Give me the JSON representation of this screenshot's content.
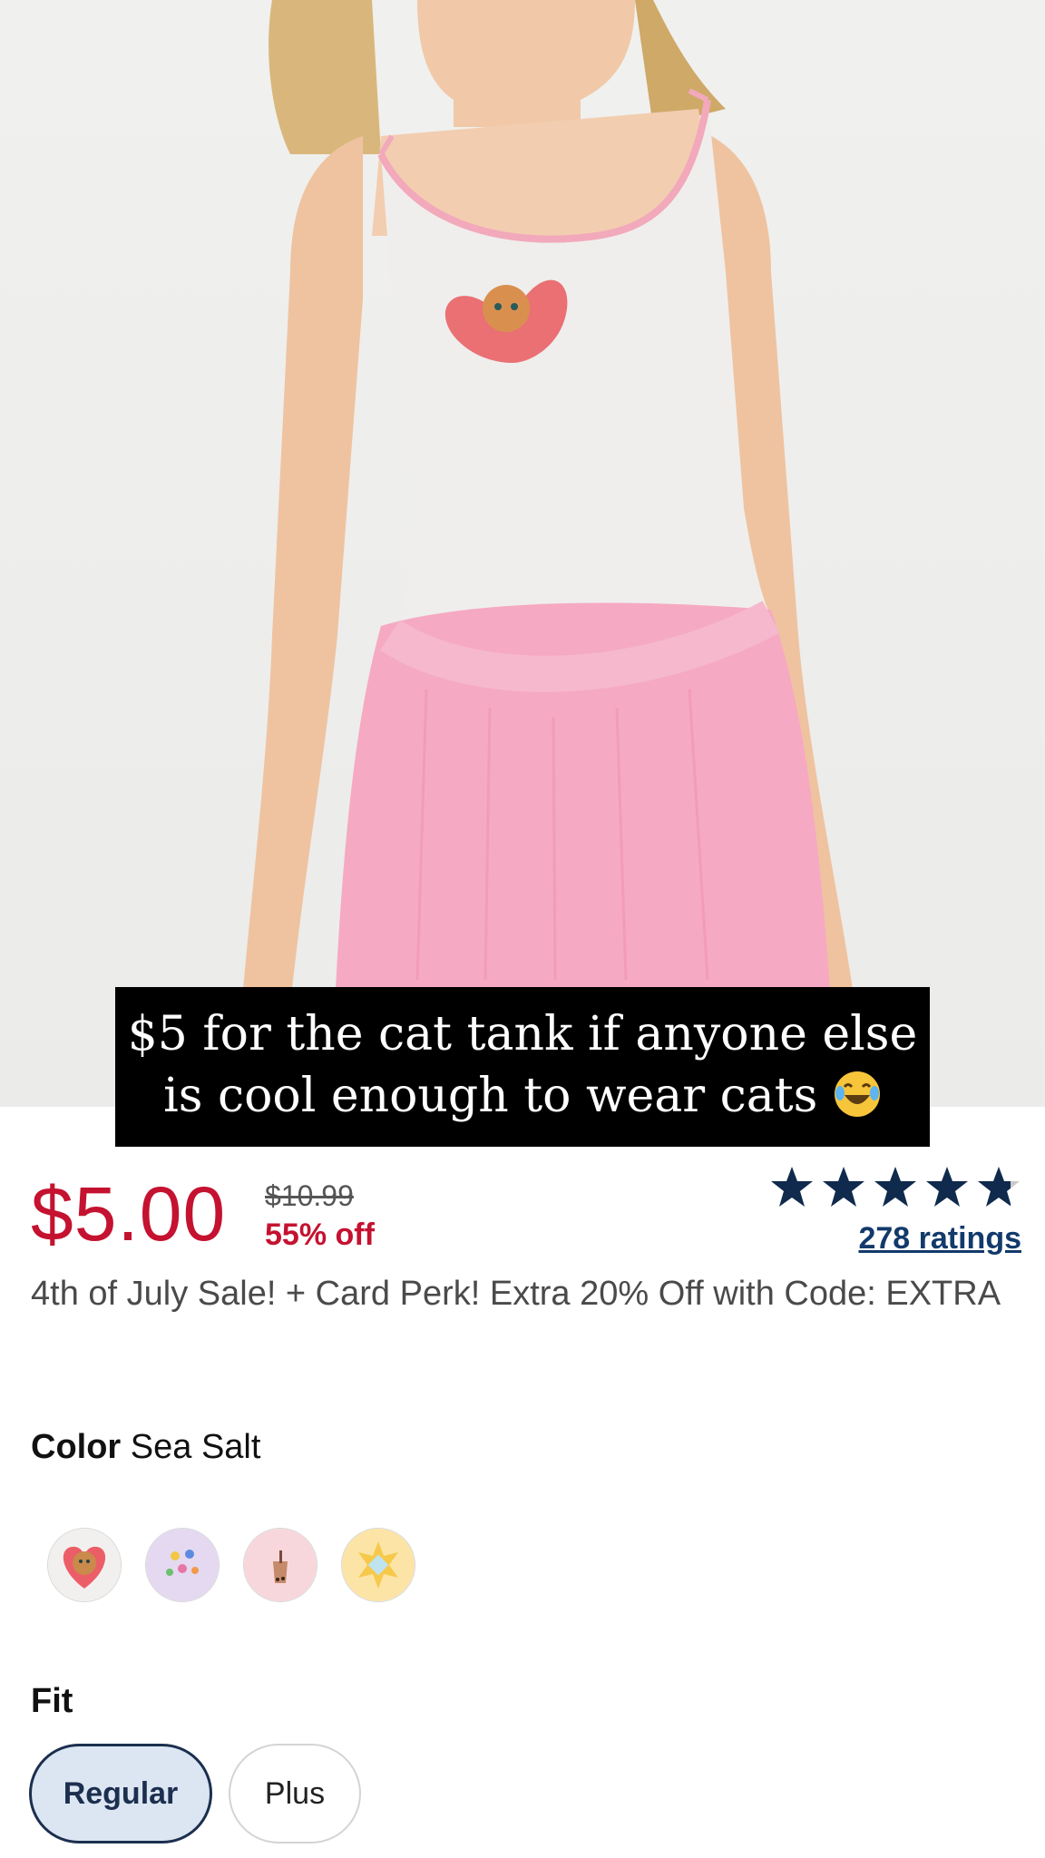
{
  "caption": {
    "line1": "$5 for the cat tank if anyone else",
    "line2": "is cool enough to wear cats"
  },
  "price": {
    "current": "$5.00",
    "original": "$10.99",
    "discount": "55% off"
  },
  "rating": {
    "stars": 4.8,
    "max_stars": 5,
    "count_label": "278 ratings"
  },
  "promo": "4th of July Sale! + Card Perk! Extra 20% Off with Code: EXTRA",
  "color": {
    "label": "Color",
    "selected": "Sea Salt",
    "swatch_icons": [
      "cat-heart-icon",
      "flowers-icon",
      "boba-icon",
      "sun-icon"
    ]
  },
  "fit": {
    "label": "Fit",
    "options": [
      "Regular",
      "Plus"
    ],
    "selected": "Regular"
  },
  "colors": {
    "price_red": "#c41230",
    "navy": "#1c2f4f",
    "link_blue": "#123a6b"
  }
}
